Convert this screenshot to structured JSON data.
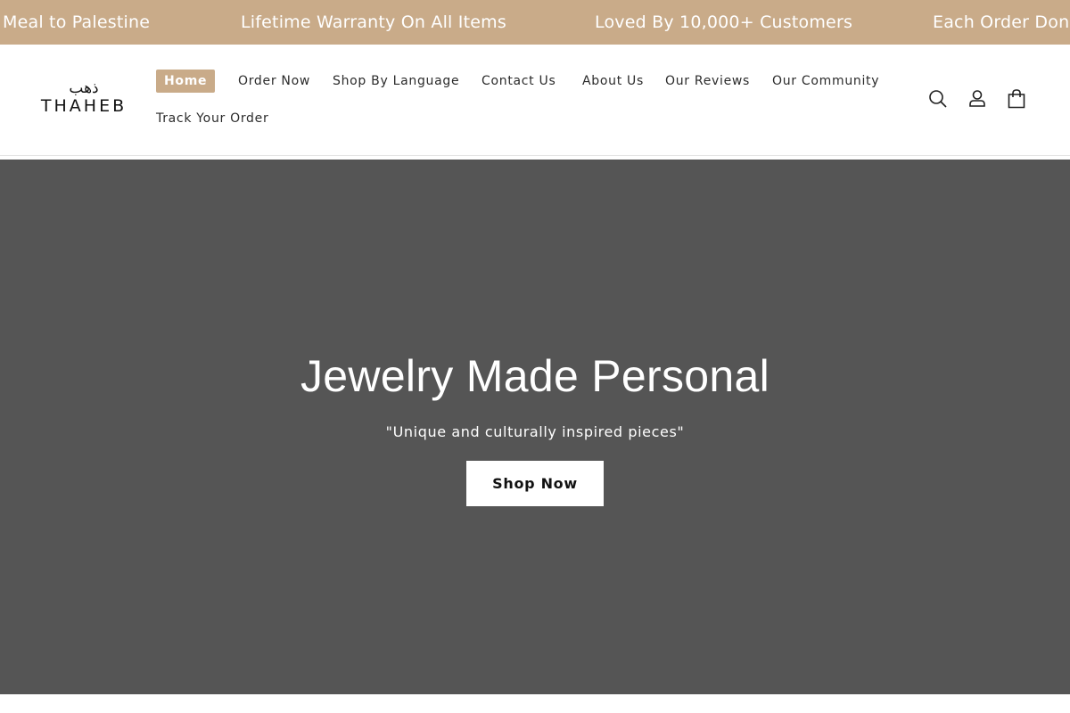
{
  "announcement_bar": {
    "items": [
      "Meal to Palestine",
      "Lifetime Warranty On All Items",
      "Loved By 10,000+ Customers",
      "Each Order Don"
    ]
  },
  "header": {
    "logo": {
      "arabic": "ذهب",
      "latin": "THAHEB"
    },
    "nav": [
      {
        "label": "Home",
        "active": true
      },
      {
        "label": "Order Now"
      },
      {
        "label": "Shop By Language"
      },
      {
        "label": "Contact Us"
      },
      {
        "label": "About Us"
      },
      {
        "label": "Our Reviews"
      },
      {
        "label": "Our Community"
      },
      {
        "label": "Track Your Order"
      }
    ],
    "icons": [
      "search-icon",
      "account-icon",
      "cart-icon"
    ]
  },
  "hero": {
    "title": "Jewelry Made Personal",
    "subtitle": "\"Unique and culturally inspired pieces\"",
    "button_label": "Shop Now"
  },
  "colors": {
    "accent": "#c9ab89",
    "hero_bg": "#555555",
    "text_dark": "#2b2b2b"
  }
}
